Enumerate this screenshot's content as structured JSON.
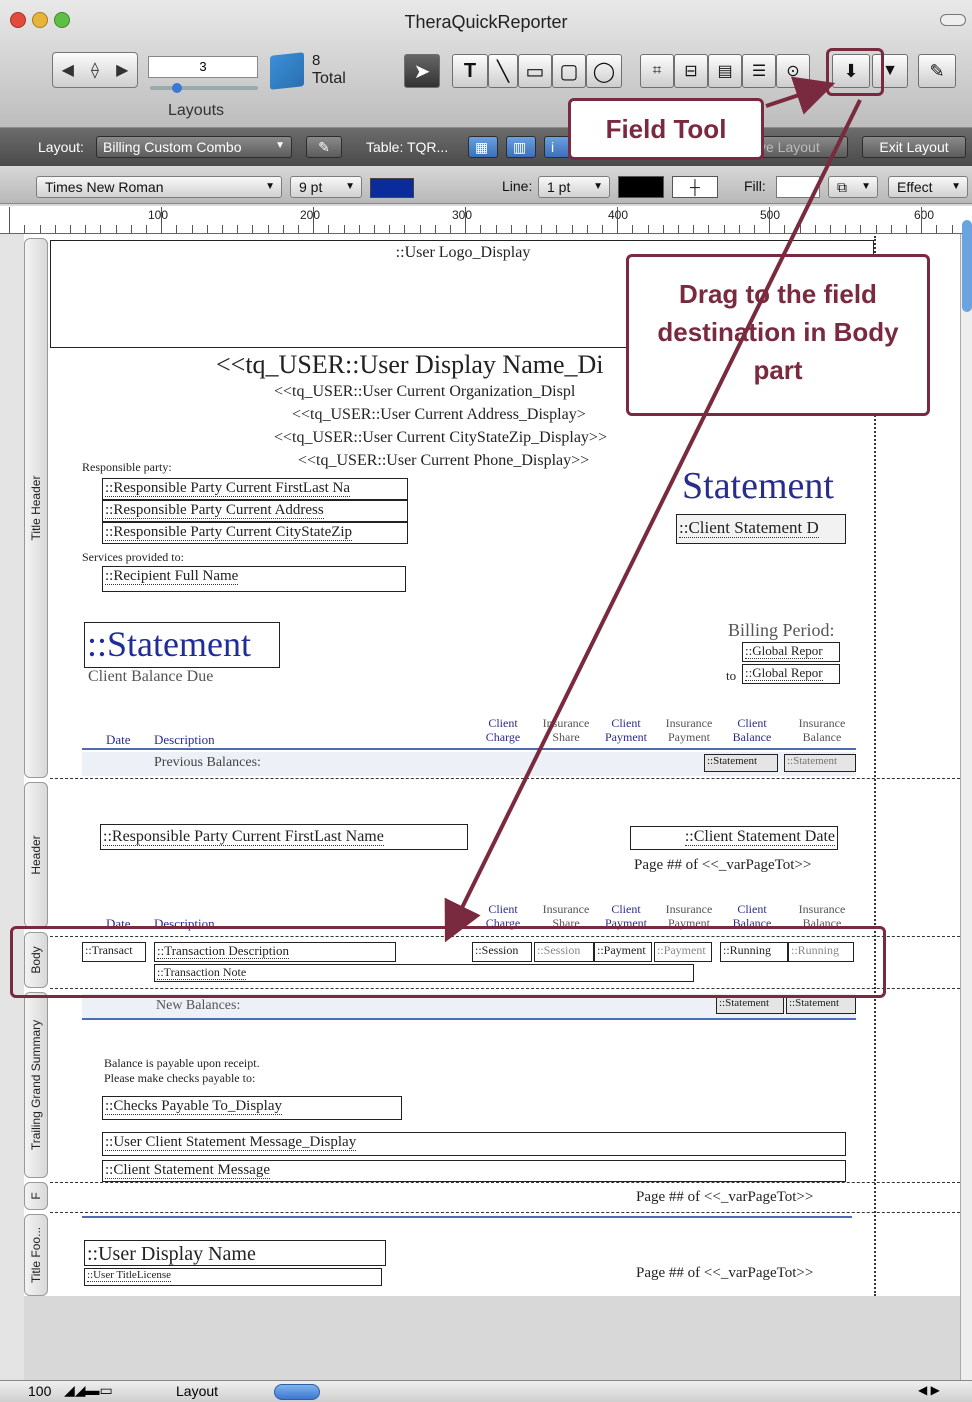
{
  "window": {
    "title": "TheraQuickReporter"
  },
  "toolbar": {
    "record_number": "3",
    "total_count": "8",
    "total_label": "Total",
    "layouts_label": "Layouts",
    "text_tool": "T"
  },
  "layout_bar": {
    "layout_label": "Layout:",
    "layout_value": "Billing Custom Combo",
    "table_label": "Table: TQR...",
    "save_layout": "ve Layout",
    "exit_layout": "Exit Layout"
  },
  "format_bar": {
    "font": "Times New Roman",
    "size": "9 pt",
    "line_label": "Line:",
    "line_value": "1 pt",
    "fill_label": "Fill:",
    "effect_label": "Effect",
    "font_color": "#0a2b9a"
  },
  "ruler": {
    "labels": [
      "100",
      "200",
      "300",
      "400",
      "500",
      "600"
    ]
  },
  "parts": {
    "title_header": "Title Header",
    "header": "Header",
    "body": "Body",
    "trailing_grand_summary": "Trailing Grand Summary",
    "footer": "F",
    "title_footer": "Title Foo..."
  },
  "layout": {
    "user_logo": "::User Logo_Display",
    "user_display_name": "<<tq_USER::User Display Name_Di",
    "org": "<<tq_USER::User Current Organization_Displ",
    "address": "<<tq_USER::User Current Address_Display>",
    "citystatezip": "<<tq_USER::User Current CityStateZip_Display>>",
    "phone": "<<tq_USER::User Current Phone_Display>>",
    "responsible_party_label": "Responsible party:",
    "rp_name": "::Responsible Party Current FirstLast Na",
    "rp_address": "::Responsible Party Current Address",
    "rp_csz": "::Responsible Party Current CityStateZip",
    "services_label": "Services provided to:",
    "recipient": "::Recipient Full Name",
    "statement_title": "Statement",
    "client_statement_d": "::Client Statement D",
    "statement_field": "::Statement",
    "client_balance_due": "Client Balance Due",
    "billing_period": "Billing Period:",
    "global_report_1": "::Global Repor",
    "to_label": "to",
    "global_report_2": "::Global Repor",
    "col_date": "Date",
    "col_description": "Description",
    "col_client_charge": "Client\nCharge",
    "col_insurance_share": "Insurance\nShare",
    "col_client_payment": "Client\nPayment",
    "col_insurance_payment": "Insurance\nPayment",
    "col_client_balance": "Client\nBalance",
    "col_insurance_balance": "Insurance\nBalance",
    "previous_balances": "Previous Balances:",
    "statement_cell": "::Statement",
    "hdr_rp_name": "::Responsible Party Current FirstLast Name",
    "hdr_client_statement_date": "::Client Statement Date",
    "page_num": "Page ## of <<_varPageTot>>",
    "body_transact": "::Transact",
    "body_transaction_description": "::Transaction Description",
    "body_transaction_note": "::Transaction Note",
    "body_session": "::Session",
    "body_payment": "::Payment",
    "body_running": "::Running",
    "new_balances": "New Balances:",
    "payable_line1": "Balance is payable upon receipt.",
    "payable_line2": "Please make checks payable to:",
    "checks_payable": "::Checks Payable To_Display",
    "user_client_msg": "::User Client Statement Message_Display",
    "client_msg": "::Client Statement Message",
    "footer_user_display_name": "::User Display Name",
    "footer_user_title": "::User TitleLicense"
  },
  "callouts": {
    "field_tool": "Field Tool",
    "drag_hint": "Drag to the field destination in Body part",
    "accent": "#7a2a3f"
  },
  "bottom": {
    "zoom": "100",
    "mode": "Layout"
  }
}
